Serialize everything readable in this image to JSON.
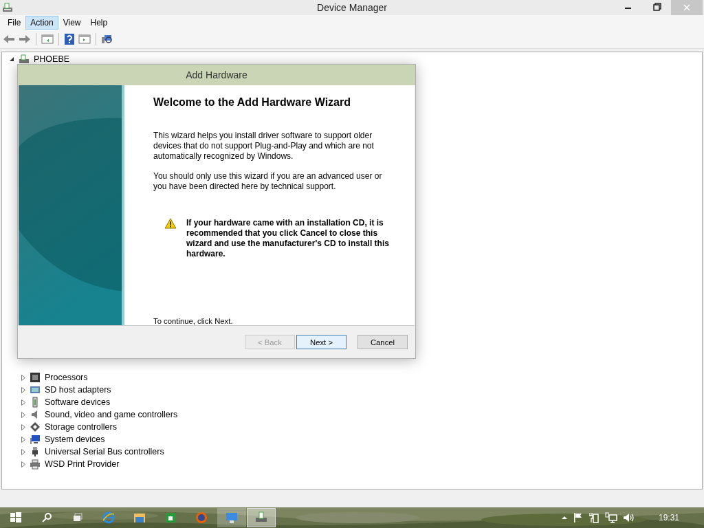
{
  "window": {
    "title": "Device Manager"
  },
  "menu": [
    {
      "label": "File",
      "selected": false
    },
    {
      "label": "Action",
      "selected": true
    },
    {
      "label": "View",
      "selected": false
    },
    {
      "label": "Help",
      "selected": false
    }
  ],
  "tree": {
    "root": {
      "label": "PHOEBE",
      "expanded": true
    },
    "children": [
      {
        "label": "Processors",
        "kind": "cpu"
      },
      {
        "label": "SD host adapters",
        "kind": "card"
      },
      {
        "label": "Software devices",
        "kind": "soft"
      },
      {
        "label": "Sound, video and game controllers",
        "kind": "sound"
      },
      {
        "label": "Storage controllers",
        "kind": "storage"
      },
      {
        "label": "System devices",
        "kind": "system"
      },
      {
        "label": "Universal Serial Bus controllers",
        "kind": "usb"
      },
      {
        "label": "WSD Print Provider",
        "kind": "printer"
      }
    ]
  },
  "dialog": {
    "title": "Add Hardware",
    "heading": "Welcome to the Add Hardware Wizard",
    "paragraphs": [
      "This wizard helps you install driver software to support older devices that do not support Plug-and-Play and which are not automatically recognized by Windows.",
      "You should only use this wizard if you are an advanced user or you have been directed here by technical support."
    ],
    "warning": "If your hardware came with an installation CD, it is recommended that you click Cancel to close this wizard and use the manufacturer's CD to install this hardware.",
    "footer_text": "To continue, click Next.",
    "buttons": [
      {
        "label": "< Back",
        "disabled": true,
        "default": false
      },
      {
        "label": "Next >",
        "disabled": false,
        "default": true
      },
      {
        "label": "Cancel",
        "disabled": false,
        "default": false
      }
    ]
  },
  "taskbar": {
    "apps": [
      {
        "kind": "start"
      },
      {
        "kind": "search"
      },
      {
        "kind": "taskview"
      },
      {
        "kind": "ie"
      },
      {
        "kind": "folder"
      },
      {
        "kind": "store"
      },
      {
        "kind": "firefox"
      },
      {
        "kind": "control",
        "selected": false
      },
      {
        "kind": "device",
        "selected": true
      }
    ],
    "clock": "19:31"
  }
}
